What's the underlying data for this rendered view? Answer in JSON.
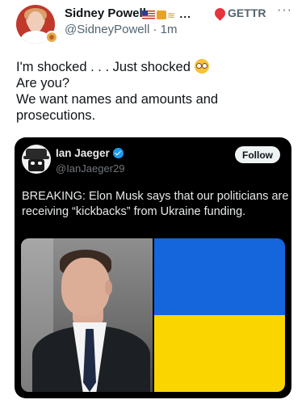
{
  "post": {
    "author_name": "Sidney Powell",
    "author_name_suffix": "...",
    "handle": "@SidneyPowell",
    "separator": "·",
    "time": "1m",
    "source_label": "GETTR",
    "more_label": "···",
    "text_lines": [
      "I'm shocked . . . Just shocked",
      "Are you?",
      "We want names and amounts and",
      "prosecutions."
    ],
    "icons": {
      "avatar": "profile-photo",
      "badge": "coin-badge",
      "flag": "us-flag-emoji",
      "tractor": "tractor-emoji",
      "wheat": "wheat-emoji",
      "source": "gettr-logo",
      "emoji": "flushed-face-emoji"
    }
  },
  "embedded": {
    "author_name": "Ian Jaeger",
    "handle": "@IanJaeger29",
    "follow_label": "Follow",
    "text_lines": [
      "BREAKING: Elon Musk says that our politicians are",
      "receiving “kickbacks” from Ukraine funding."
    ],
    "colors": {
      "card_bg": "#000000",
      "verified": "#1d9bf0",
      "ukraine_blue": "#1565dd",
      "ukraine_yellow": "#fbd500"
    }
  }
}
